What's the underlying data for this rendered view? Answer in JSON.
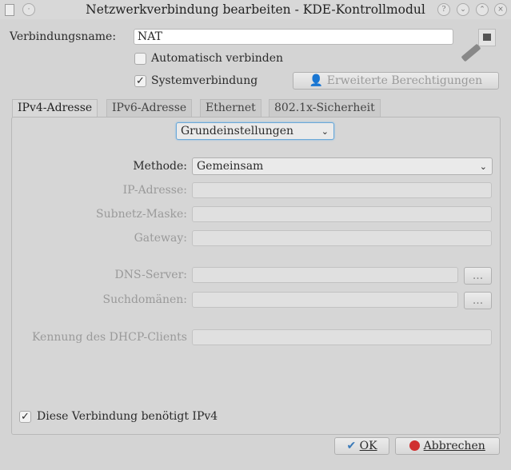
{
  "window": {
    "title": "Netzwerkverbindung bearbeiten - KDE-Kontrollmodul",
    "buttons": {
      "help": "?",
      "minimize": "⌄",
      "maximize": "⌃",
      "close": "×"
    }
  },
  "connection": {
    "name_label": "Verbindungsname:",
    "name_value": "NAT",
    "auto_connect": {
      "label": "Automatisch verbinden",
      "checked": false
    },
    "system_connection": {
      "label": "Systemverbindung",
      "checked": true
    },
    "advanced_permissions": "Erweiterte Berechtigungen"
  },
  "tabs": [
    {
      "label": "IPv4-Adresse",
      "active": true
    },
    {
      "label": "IPv6-Adresse"
    },
    {
      "label": "Ethernet"
    },
    {
      "label": "802.1x-Sicherheit"
    }
  ],
  "ipv4": {
    "mode": "Grundeinstellungen",
    "method_label": "Methode:",
    "method_value": "Gemeinsam",
    "ip_label": "IP-Adresse:",
    "subnet_label": "Subnetz-Maske:",
    "gateway_label": "Gateway:",
    "dns_label": "DNS-Server:",
    "search_label": "Suchdomänen:",
    "dhcp_label": "Kennung des DHCP-Clients",
    "browse": "...",
    "require": {
      "label": "Diese Verbindung benötigt IPv4",
      "checked": true
    }
  },
  "footer": {
    "ok": "OK",
    "cancel": "Abbrechen"
  }
}
